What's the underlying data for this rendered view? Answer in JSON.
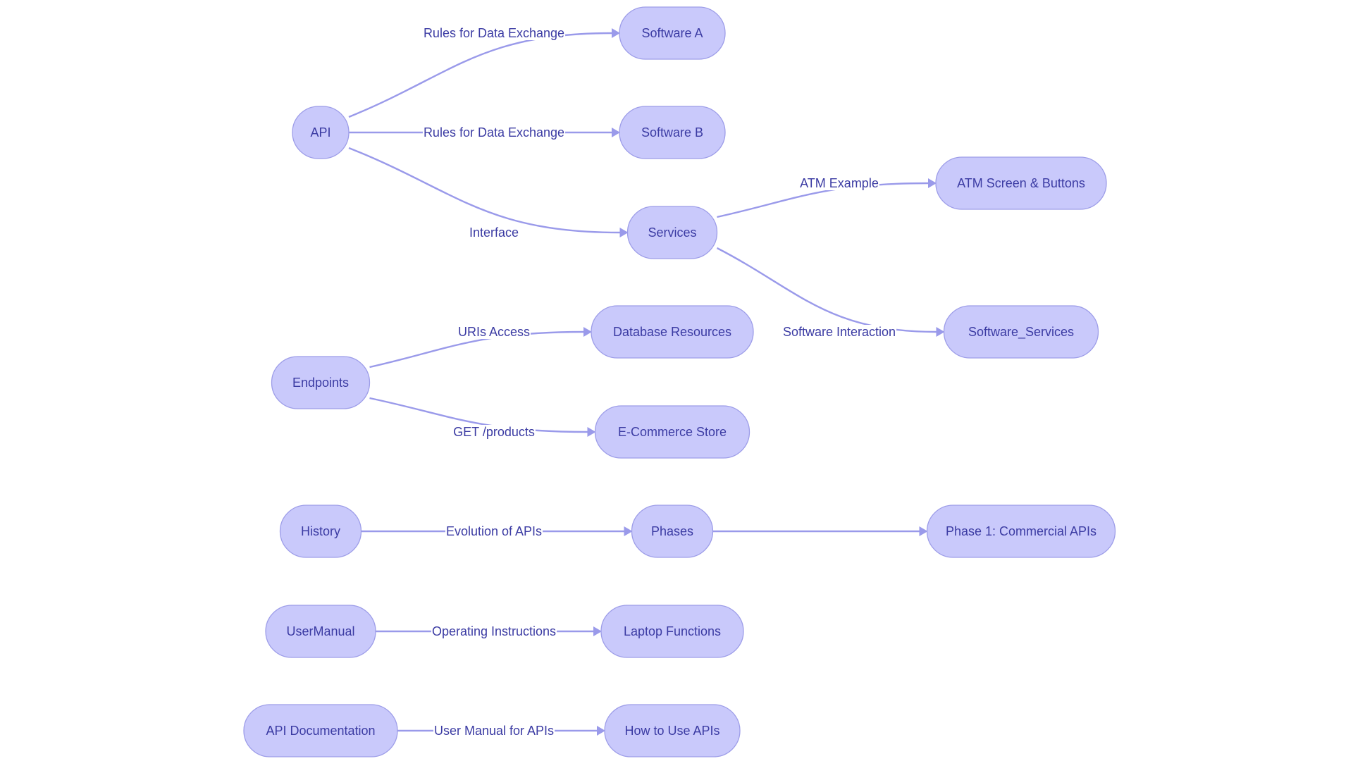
{
  "diagram": {
    "type": "flowchart",
    "direction": "left-to-right",
    "colors": {
      "node_fill": "#c9c9fb",
      "node_stroke": "#9d9de8",
      "text": "#3b3ba3",
      "edge": "#9a9aea",
      "background": "#ffffff"
    },
    "nodes": [
      {
        "id": "api",
        "label": "API"
      },
      {
        "id": "software_a",
        "label": "Software A"
      },
      {
        "id": "software_b",
        "label": "Software B"
      },
      {
        "id": "services",
        "label": "Services"
      },
      {
        "id": "atm",
        "label": "ATM Screen & Buttons"
      },
      {
        "id": "software_services",
        "label": "Software_Services"
      },
      {
        "id": "endpoints",
        "label": "Endpoints"
      },
      {
        "id": "database_resources",
        "label": "Database Resources"
      },
      {
        "id": "ecommerce",
        "label": "E-Commerce Store"
      },
      {
        "id": "history",
        "label": "History"
      },
      {
        "id": "phases",
        "label": "Phases"
      },
      {
        "id": "phase1",
        "label": "Phase 1: Commercial APIs"
      },
      {
        "id": "usermanual",
        "label": "UserManual"
      },
      {
        "id": "laptop",
        "label": "Laptop Functions"
      },
      {
        "id": "api_docs",
        "label": "API Documentation"
      },
      {
        "id": "how_to_use",
        "label": "How to Use APIs"
      }
    ],
    "edges": [
      {
        "from": "api",
        "to": "software_a",
        "label": "Rules for Data Exchange"
      },
      {
        "from": "api",
        "to": "software_b",
        "label": "Rules for Data Exchange"
      },
      {
        "from": "api",
        "to": "services",
        "label": "Interface"
      },
      {
        "from": "services",
        "to": "atm",
        "label": "ATM Example"
      },
      {
        "from": "services",
        "to": "software_services",
        "label": "Software Interaction"
      },
      {
        "from": "endpoints",
        "to": "database_resources",
        "label": "URIs Access"
      },
      {
        "from": "endpoints",
        "to": "ecommerce",
        "label": "GET /products"
      },
      {
        "from": "history",
        "to": "phases",
        "label": "Evolution of APIs"
      },
      {
        "from": "phases",
        "to": "phase1",
        "label": ""
      },
      {
        "from": "usermanual",
        "to": "laptop",
        "label": "Operating Instructions"
      },
      {
        "from": "api_docs",
        "to": "how_to_use",
        "label": "User Manual for APIs"
      }
    ]
  }
}
